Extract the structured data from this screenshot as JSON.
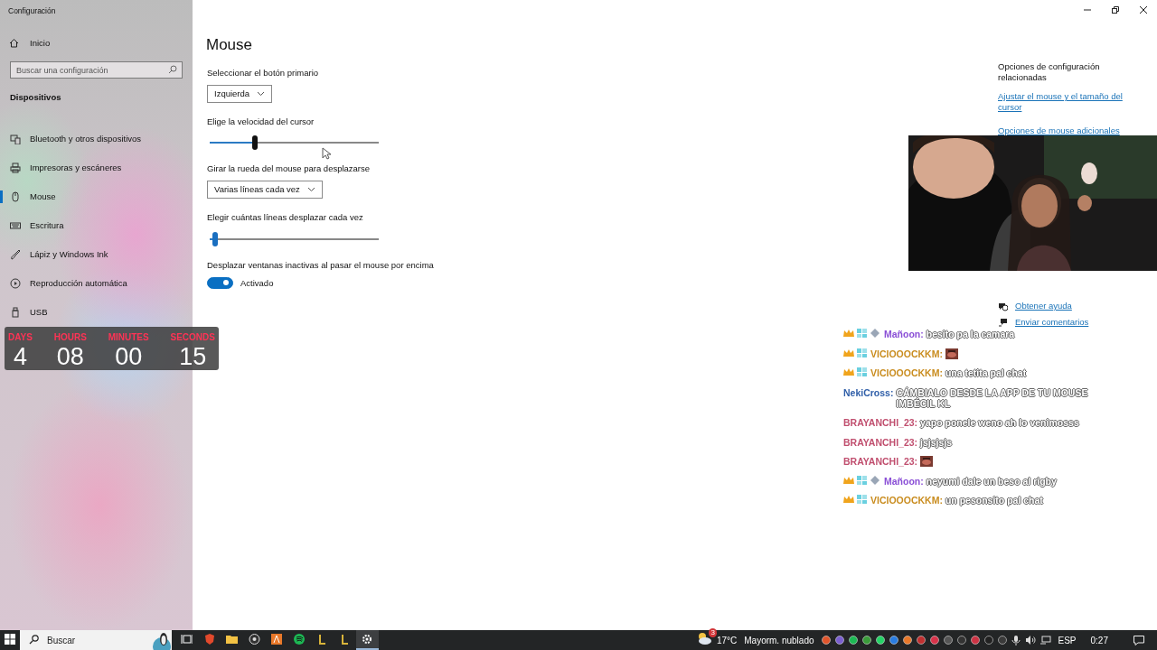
{
  "window": {
    "title": "Configuración"
  },
  "sidebar": {
    "home": "Inicio",
    "search": {
      "placeholder": "Buscar una configuración"
    },
    "section": "Dispositivos",
    "items": [
      {
        "kind": "bluetooth",
        "label": "Bluetooth y otros dispositivos",
        "selected": false
      },
      {
        "kind": "printer",
        "label": "Impresoras y escáneres",
        "selected": false
      },
      {
        "kind": "mouse",
        "label": "Mouse",
        "selected": true
      },
      {
        "kind": "keyboard",
        "label": "Escritura",
        "selected": false
      },
      {
        "kind": "pen",
        "label": "Lápiz y Windows Ink",
        "selected": false
      },
      {
        "kind": "autoplay",
        "label": "Reproducción automática",
        "selected": false
      },
      {
        "kind": "usb",
        "label": "USB",
        "selected": false
      }
    ]
  },
  "page": {
    "title": "Mouse",
    "settings": [
      {
        "kind": "dropdown",
        "label": "Seleccionar el botón primario",
        "value": "Izquierda"
      },
      {
        "kind": "slider",
        "label": "Elige la velocidad del cursor",
        "level": 0.27
      },
      {
        "kind": "dropdown",
        "label": "Girar la rueda del mouse para desplazarse",
        "value": "Varias líneas cada vez"
      },
      {
        "kind": "slider",
        "label": "Elegir cuántas líneas desplazar cada vez",
        "level": 0.03
      },
      {
        "kind": "toggle",
        "label": "Desplazar ventanas inactivas al pasar el mouse por encima",
        "on": true,
        "state_text": "Activado"
      }
    ]
  },
  "related": {
    "title": "Opciones de configuración relacionadas",
    "links": [
      "Ajustar el mouse y el tamaño del cursor",
      "Opciones de mouse adicionales"
    ]
  },
  "help": [
    {
      "kind": "help",
      "label": "Obtener ayuda"
    },
    {
      "kind": "feedback",
      "label": "Enviar comentarios"
    }
  ],
  "countdown": [
    {
      "label": "DAYS",
      "value": "4"
    },
    {
      "label": "HOURS",
      "value": "08"
    },
    {
      "label": "MINUTES",
      "value": "00"
    },
    {
      "label": "SECONDS",
      "value": "15"
    }
  ],
  "chat": [
    {
      "kind": "supporter",
      "user": "Mañoon:",
      "color": "#8a4fd6",
      "text": "besito pa la camara"
    },
    {
      "kind": "subscriber",
      "user": "VICIOOOCKKM:",
      "color": "#c98c1e",
      "emote": true
    },
    {
      "kind": "subscriber",
      "user": "VICIOOOCKKM:",
      "color": "#c98c1e",
      "text": "una tetita pal chat"
    },
    {
      "kind": "viewer",
      "user": "NekiCross:",
      "color": "#2f5ea8",
      "text": "CÁMBIALO DESDE LA APP DE TU MOUSE IMBÉCIL KL"
    },
    {
      "kind": "viewer",
      "user": "BRAYANCHI_23:",
      "color": "#c04e6e",
      "text": "yapo ponele weno ah lo venimosss"
    },
    {
      "kind": "viewer",
      "user": "BRAYANCHI_23:",
      "color": "#c04e6e",
      "text": "jsjsjsjs"
    },
    {
      "kind": "viewer",
      "user": "BRAYANCHI_23:",
      "color": "#c04e6e",
      "emote": true
    },
    {
      "kind": "supporter",
      "user": "Mañoon:",
      "color": "#8a4fd6",
      "text": "neyumi dale un beso al rigby"
    },
    {
      "kind": "subscriber",
      "user": "VICIOOOCKKM:",
      "color": "#c98c1e",
      "text": "un pesonsito pal chat"
    }
  ],
  "taskbar": {
    "search": {
      "placeholder": "Buscar"
    },
    "apps": [
      {
        "kind": "taskview",
        "selected": false
      },
      {
        "kind": "browser",
        "selected": false
      },
      {
        "kind": "folder",
        "selected": false
      },
      {
        "kind": "recorder",
        "selected": false
      },
      {
        "kind": "editor",
        "selected": false
      },
      {
        "kind": "music",
        "selected": false
      },
      {
        "kind": "launcher",
        "selected": false
      },
      {
        "kind": "launcher",
        "selected": false
      },
      {
        "kind": "settings",
        "selected": true
      }
    ],
    "weather_badge": "3",
    "temperature": "17°C",
    "weather": "Mayorm. nublado",
    "language": "ESP",
    "time": "0:27"
  }
}
